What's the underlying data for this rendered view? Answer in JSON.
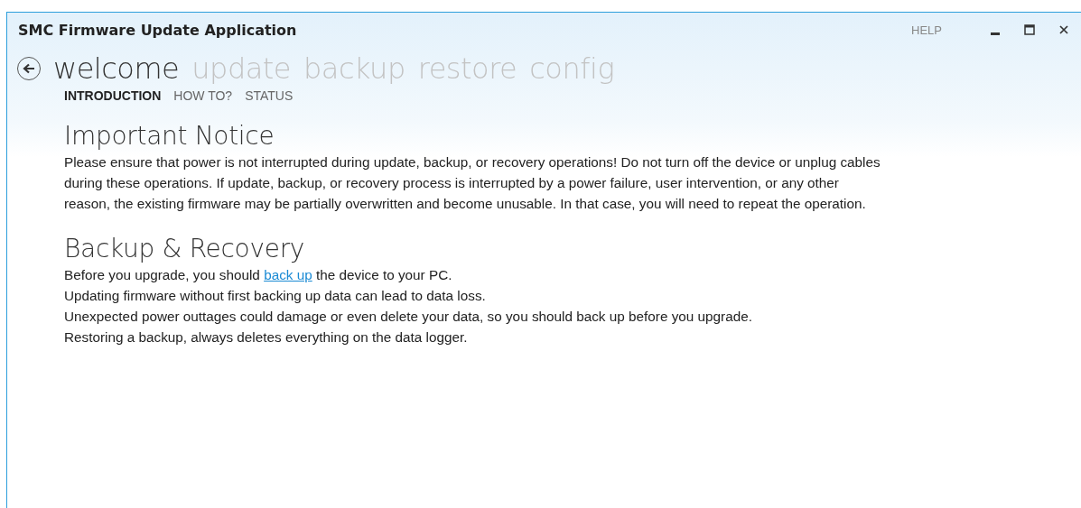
{
  "window": {
    "title": "SMC Firmware Update Application",
    "help": "HELP"
  },
  "nav": [
    {
      "label": "welcome",
      "selected": true
    },
    {
      "label": "update",
      "selected": false
    },
    {
      "label": "backup",
      "selected": false
    },
    {
      "label": "restore",
      "selected": false
    },
    {
      "label": "config",
      "selected": false
    }
  ],
  "subtabs": [
    {
      "label": "INTRODUCTION",
      "selected": true
    },
    {
      "label": "HOW TO?",
      "selected": false
    },
    {
      "label": "STATUS",
      "selected": false
    }
  ],
  "notice": {
    "heading": "Important Notice",
    "lines": [
      "Please ensure that power is not interrupted during update, backup, or recovery operations! Do not turn off the device or unplug cables",
      "during these operations. If update, backup, or recovery process is interrupted by a power failure, user intervention, or any other",
      "reason, the existing firmware may be partially overwritten and become unusable. In that case, you will need to repeat the operation."
    ]
  },
  "backup": {
    "heading": "Backup & Recovery",
    "intro": {
      "before": "Before you upgrade, you should ",
      "link": "back up",
      "after": " the device to your PC."
    },
    "lines": [
      "Updating firmware without first backing up data can lead to data loss.",
      "Unexpected power outtages could damage or even delete your data, so you should back up before you upgrade.",
      "Restoring a backup, always deletes everything on the data logger."
    ]
  }
}
